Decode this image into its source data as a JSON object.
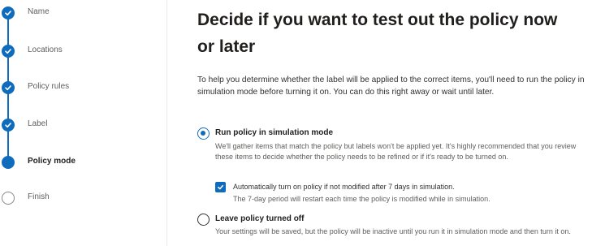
{
  "wizard": {
    "steps": [
      {
        "label": "Name",
        "state": "done"
      },
      {
        "label": "Locations",
        "state": "done"
      },
      {
        "label": "Policy rules",
        "state": "done"
      },
      {
        "label": "Label",
        "state": "done"
      },
      {
        "label": "Policy mode",
        "state": "current"
      },
      {
        "label": "Finish",
        "state": "todo"
      }
    ]
  },
  "main": {
    "title": "Decide if you want to test out the policy now or later",
    "intro": "To help you determine whether the label will be applied to the correct items, you'll need to run the policy in simulation mode before turning it on. You can do this right away or wait until later.",
    "options": [
      {
        "label": "Run policy in simulation mode",
        "description": "We'll gather items that match the policy but labels won't be applied yet. It's highly recommended that you review these items to decide whether the policy needs to be refined or if it's ready to be turned on.",
        "selected": true
      },
      {
        "label": "Leave policy turned off",
        "description": "Your settings will be saved, but the policy will be inactive until you run it in simulation mode and then turn it on.",
        "selected": false
      }
    ],
    "auto_turn_on": {
      "label": "Automatically turn on policy if not modified after 7 days in simulation.",
      "note": "The 7-day period will restart each time the policy is modified while in simulation.",
      "checked": true
    }
  },
  "colors": {
    "accent": "#0f6cbd",
    "text": "#323130",
    "muted": "#605e5c"
  }
}
